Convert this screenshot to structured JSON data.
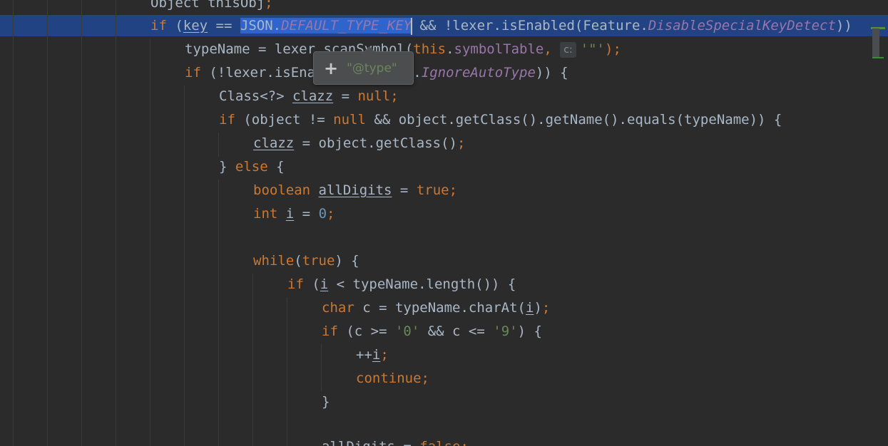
{
  "code": {
    "line0": {
      "a": "Object thisObj",
      "b": ";"
    },
    "line1": {
      "kw_if": "if",
      "p1": " (",
      "key": "key",
      "p2": " == ",
      "json": "JSON.",
      "const": "DEFAULT_TYPE_KEY",
      "p3": " && !lexer.isEnabled(Feature.",
      "feature": "DisableSpecialKeyDetect",
      "p4": "))"
    },
    "line2": {
      "a": "typeName = lexer.scanSymbol(",
      "kw_this": "this",
      "dot": ".",
      "field": "symbolTable",
      "comma": ", ",
      "hint": "c:",
      "str": "'\"'",
      "end": ");"
    },
    "line3": {
      "kw_if": "if",
      "a": " (!lexer.isEnabled(Feature.",
      "const": "IgnoreAutoType",
      "b": ")) {"
    },
    "line4": {
      "a": "Class<?> ",
      "var": "clazz",
      "b": " = ",
      "kw_null": "null",
      "semi": ";"
    },
    "line5": {
      "kw_if": "if",
      "a": " (object != ",
      "kw_null": "null",
      "b": " && object.getClass().getName().equals(typeName)) {"
    },
    "line6": {
      "var": "clazz",
      "a": " = object.getClass()",
      "semi": ";"
    },
    "line7": {
      "a": "} ",
      "kw_else": "else",
      "b": " {"
    },
    "line8": {
      "kw_boolean": "boolean",
      "sp": " ",
      "var": "allDigits",
      "a": " = ",
      "kw_true": "true",
      "semi": ";"
    },
    "line9": {
      "kw_int": "int",
      "sp": " ",
      "var": "i",
      "a": " = ",
      "num": "0",
      "semi": ";"
    },
    "line11": {
      "kw_while": "while",
      "a": "(",
      "kw_true": "true",
      "b": ") {"
    },
    "line12": {
      "kw_if": "if",
      "a": " (",
      "var": "i",
      "b": " < typeName.length()) {"
    },
    "line13": {
      "kw_char": "char",
      "a": " c = typeName.charAt(",
      "var": "i",
      "b": ")",
      "semi": ";"
    },
    "line14": {
      "kw_if": "if",
      "a": " (c >= ",
      "str1": "'0'",
      "b": " && c <= ",
      "str2": "'9'",
      "c": ") {"
    },
    "line15": {
      "a": "++",
      "var": "i",
      "semi": ";"
    },
    "line16": {
      "kw_continue": "continue",
      "semi": ";"
    },
    "line17": {
      "a": "}"
    },
    "line19": {
      "var": "allDigits",
      "a": " = ",
      "kw_false": "false",
      "semi": ";"
    }
  },
  "popup": {
    "plus": "+",
    "value": "\"@type\""
  },
  "colors": {
    "background": "#2b2b2b",
    "keyword": "#cc7832",
    "string": "#6a8759",
    "number": "#6897bb",
    "constant": "#9876aa",
    "selection": "#214283"
  }
}
